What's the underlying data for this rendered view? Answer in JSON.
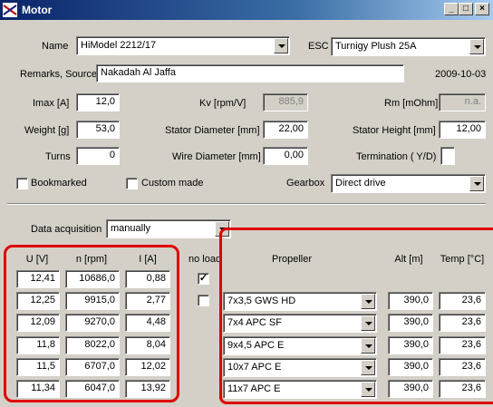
{
  "window": {
    "title": "Motor"
  },
  "name": {
    "label": "Name",
    "value": "HiModel 2212/17"
  },
  "esc": {
    "label": "ESC",
    "value": "Turnigy Plush 25A"
  },
  "remarks": {
    "label": "Remarks, Source",
    "value": "Nakadah Al Jaffa",
    "date": "2009-10-03"
  },
  "imax": {
    "label": "Imax [A]",
    "value": "12,0"
  },
  "kv": {
    "label": "Kv [rpm/V]",
    "value": "885,9"
  },
  "rm": {
    "label": "Rm [mOhm]",
    "value": "n.a."
  },
  "weight": {
    "label": "Weight [g]",
    "value": "53,0"
  },
  "stator_diameter": {
    "label": "Stator Diameter [mm]",
    "value": "22,00"
  },
  "stator_height": {
    "label": "Stator Height [mm]",
    "value": "12,00"
  },
  "turns": {
    "label": "Turns",
    "value": "0"
  },
  "wire_diameter": {
    "label": "Wire Diameter [mm]",
    "value": "0,00"
  },
  "termination": {
    "label": "Termination ( Y/D)",
    "value": ""
  },
  "bookmarked": {
    "label": "Bookmarked",
    "checked": false
  },
  "custom_made": {
    "label": "Custom made",
    "checked": false
  },
  "gearbox": {
    "label": "Gearbox",
    "value": "Direct drive"
  },
  "data_acquisition": {
    "label": "Data acquisition",
    "value": "manually"
  },
  "table": {
    "headers": {
      "u": "U [V]",
      "n": "n [rpm]",
      "i": "I [A]",
      "noload": "no load",
      "propeller": "Propeller",
      "alt": "Alt [m]",
      "temp": "Temp [°C]"
    },
    "rows": [
      {
        "u": "12,41",
        "n": "10686,0",
        "i": "0,88",
        "noload": true,
        "propeller": "",
        "alt": "",
        "temp": ""
      },
      {
        "u": "12,25",
        "n": "9915,0",
        "i": "2,77",
        "noload": false,
        "propeller": "7x3,5 GWS HD",
        "alt": "390,0",
        "temp": "23,6"
      },
      {
        "u": "12,09",
        "n": "9270,0",
        "i": "4,48",
        "propeller": "7x4 APC SF",
        "alt": "390,0",
        "temp": "23,6"
      },
      {
        "u": "11,8",
        "n": "8022,0",
        "i": "8,04",
        "propeller": "9x4,5 APC E",
        "alt": "390,0",
        "temp": "23,6"
      },
      {
        "u": "11,5",
        "n": "6707,0",
        "i": "12,02",
        "propeller": "10x7 APC E",
        "alt": "390,0",
        "temp": "23,6"
      },
      {
        "u": "11,34",
        "n": "6047,0",
        "i": "13,92",
        "propeller": "11x7 APC E",
        "alt": "390,0",
        "temp": "23,6"
      }
    ]
  },
  "colors": {
    "annotation": "#e00000",
    "titlebar": "#0a246a",
    "face": "#d4d0c8"
  }
}
